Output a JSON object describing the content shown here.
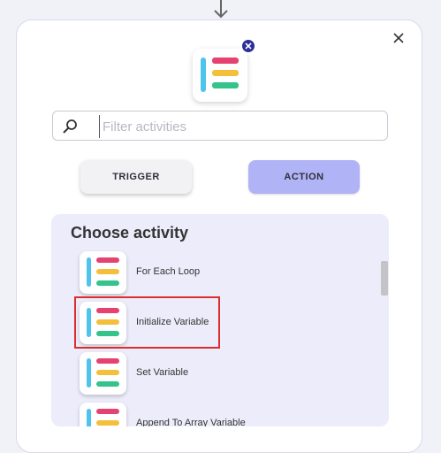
{
  "search": {
    "placeholder": "Filter activities"
  },
  "tabs": [
    {
      "label": "TRIGGER",
      "selected": false
    },
    {
      "label": "ACTION",
      "selected": true
    }
  ],
  "panel": {
    "title": "Choose activity",
    "activities": [
      {
        "label": "For Each Loop"
      },
      {
        "label": "Initialize Variable",
        "highlighted": true
      },
      {
        "label": "Set Variable"
      },
      {
        "label": "Append To Array Variable"
      }
    ]
  },
  "colors": {
    "icon_bar_blue": "#4cc4ec",
    "icon_bar_pink": "#e54271",
    "icon_bar_yellow": "#f4bf3a",
    "icon_bar_green": "#34c38a",
    "action_tab": "#b1b3f7",
    "highlight": "#dc2e2e"
  }
}
